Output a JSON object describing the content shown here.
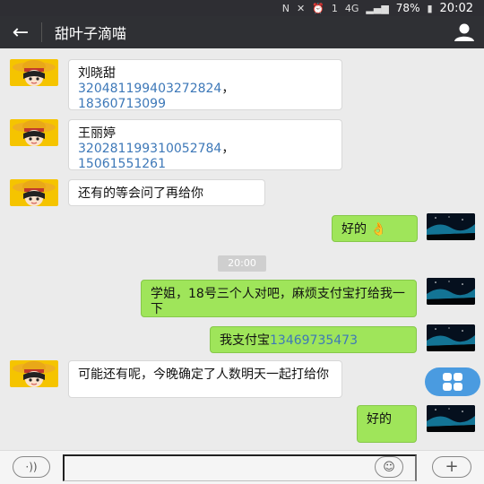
{
  "status_bar": {
    "battery": "78%",
    "time": "20:02",
    "network": "4G"
  },
  "header": {
    "title": "甜叶子滴喵"
  },
  "messages": [
    {
      "dir": "in",
      "lines": [
        "刘晓甜"
      ],
      "num1": "320481199403272824",
      "sep": "，",
      "num2": "18360713099"
    },
    {
      "dir": "in",
      "lines": [
        "王丽婷"
      ],
      "num1": "320281199310052784",
      "sep": "，",
      "num2": "15061551261"
    },
    {
      "dir": "in",
      "text": "还有的等会问了再给你"
    },
    {
      "dir": "out",
      "text": "好的",
      "emoji": "👌"
    },
    {
      "time": "20:00"
    },
    {
      "dir": "out",
      "text": "学姐，18号三个人对吧，麻烦支付宝打给我一下"
    },
    {
      "dir": "out",
      "text": "我支付宝",
      "num": "13469735473"
    },
    {
      "dir": "in",
      "text": "可能还有呢，今晚确定了人数明天一起打给你"
    },
    {
      "dir": "out",
      "text": "好的"
    }
  ],
  "input": {
    "placeholder": ""
  },
  "colors": {
    "title_bar": "#2f3034",
    "bubble_out": "#9fe55a",
    "bubble_in": "#ffffff",
    "link": "#3d78b8"
  }
}
